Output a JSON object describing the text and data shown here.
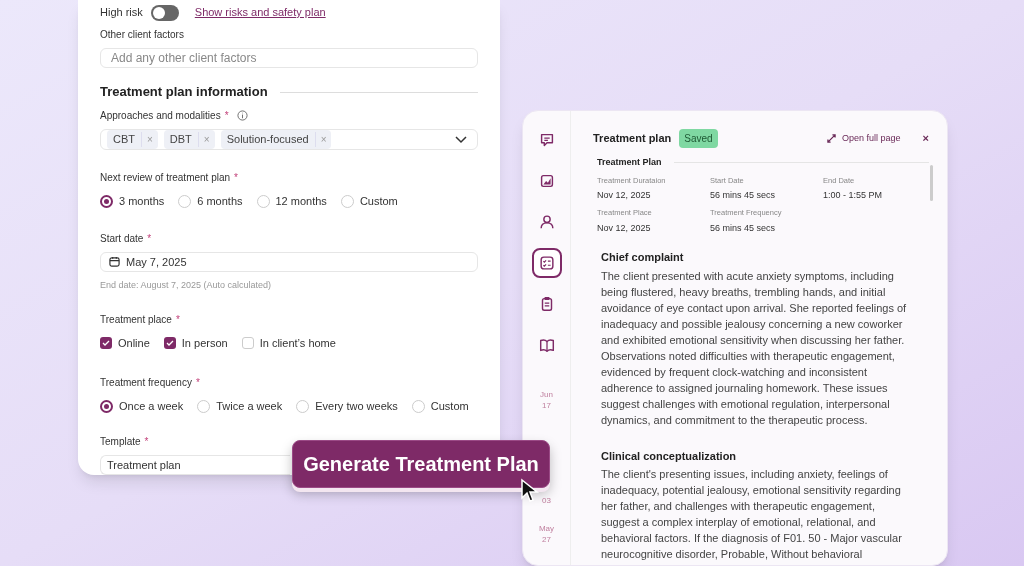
{
  "form": {
    "high_risk": {
      "label": "High risk",
      "on": false
    },
    "risk_link": "Show risks and safety plan",
    "other_factors": {
      "label": "Other client factors",
      "placeholder": "Add any other client factors"
    },
    "section_title": "Treatment plan information",
    "approaches": {
      "label": "Approaches and modalities",
      "required": "*",
      "tags": [
        {
          "label": "CBT",
          "remove": "×"
        },
        {
          "label": "DBT",
          "remove": "×"
        },
        {
          "label": "Solution-focused",
          "remove": "×"
        }
      ]
    },
    "next_review": {
      "label": "Next review of treatment plan",
      "required": "*",
      "options": [
        {
          "label": "3 months",
          "selected": true
        },
        {
          "label": "6 months",
          "selected": false
        },
        {
          "label": "12 months",
          "selected": false
        },
        {
          "label": "Custom",
          "selected": false
        }
      ]
    },
    "start_date": {
      "label": "Start date",
      "required": "*",
      "value": "May 7, 2025",
      "hint": "End date: August 7, 2025 (Auto calculated)"
    },
    "treatment_place": {
      "label": "Treatment place",
      "required": "*",
      "options": [
        {
          "label": "Online",
          "checked": true
        },
        {
          "label": "In person",
          "checked": true
        },
        {
          "label": "In client’s home",
          "checked": false
        }
      ]
    },
    "frequency": {
      "label": "Treatment frequency",
      "required": "*",
      "options": [
        {
          "label": "Once a week",
          "selected": true
        },
        {
          "label": "Twice a week",
          "selected": false
        },
        {
          "label": "Every two weeks",
          "selected": false
        },
        {
          "label": "Custom",
          "selected": false
        }
      ]
    },
    "template": {
      "label": "Template",
      "required": "*",
      "value": "Treatment plan"
    }
  },
  "generate_button": "Generate Treatment Plan",
  "panel": {
    "rail": [
      {
        "kind": "chat",
        "selected": false
      },
      {
        "kind": "chart",
        "selected": false
      },
      {
        "kind": "person",
        "selected": false
      },
      {
        "kind": "list",
        "selected": true
      },
      {
        "kind": "clipboard",
        "selected": false
      },
      {
        "kind": "book",
        "selected": false
      }
    ],
    "rail_dates": [
      {
        "month": "Jun",
        "day": "17"
      },
      {
        "day": "03"
      },
      {
        "month": "May",
        "day": "27"
      }
    ],
    "title": "Treatment plan",
    "status": "Saved",
    "open_full": "Open full page",
    "close": "×",
    "section": "Treatment Plan",
    "fields": [
      {
        "label": "Treatment Durataion",
        "value": "Nov 12, 2025"
      },
      {
        "label": "Start Date",
        "value": "56 mins 45 secs"
      },
      {
        "label": "End Date",
        "value": "1:00 - 1:55 PM"
      },
      {
        "label": "Treatment Place",
        "value": "Nov 12, 2025"
      },
      {
        "label": "Treatment Frequency",
        "value": "56 mins 45 secs"
      }
    ],
    "notes": [
      {
        "heading": "Chief complaint",
        "text": "The client presented with acute anxiety symptoms, including being flustered, heavy breaths, trembling hands, and initial avoidance of eye contact upon arrival. She reported feelings of inadequacy and possible jealousy concerning a new coworker and exhibited emotional sensitivity when discussing her father. Observations noted difficulties with therapeutic engagement, evidenced by frequent clock-watching and inconsistent adherence to assigned journaling homework. These issues suggest challenges with emotional regulation, interpersonal dynamics, and commitment to the therapeutic process."
      },
      {
        "heading": "Clinical conceptualization",
        "text": "The client's presenting issues, including anxiety, feelings of inadequacy, potential jealousy, emotional sensitivity regarding her father, and challenges with therapeutic engagement, suggest a complex interplay of emotional, relational, and behavioral factors. If the diagnosis of F01. 50 - Major vascular neurocognitive disorder, Probable, Without behavioral"
      }
    ]
  }
}
